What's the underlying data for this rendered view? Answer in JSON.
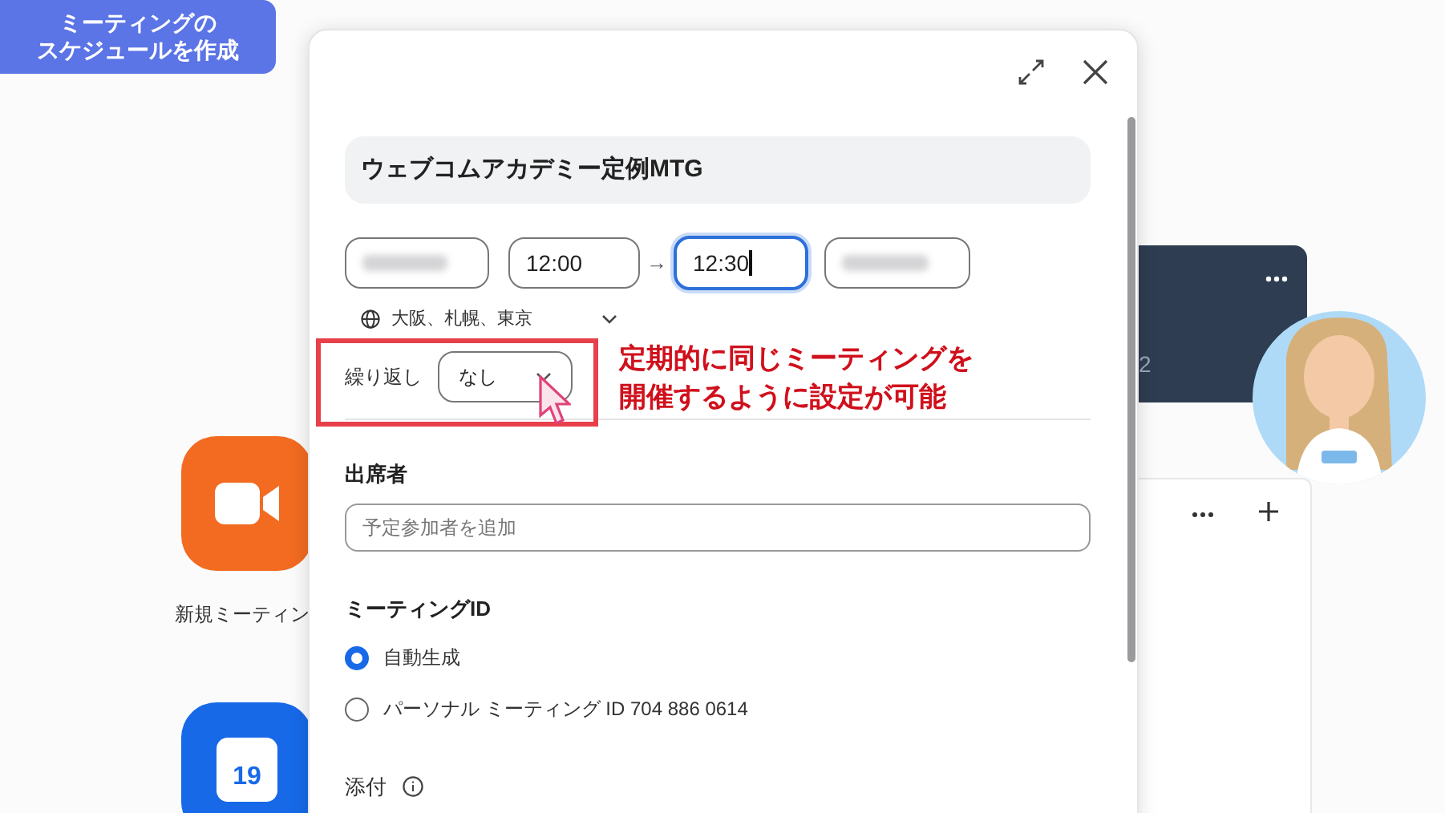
{
  "badge": {
    "lines": [
      "ミーティングの",
      "スケジュールを作成"
    ]
  },
  "background_app": {
    "new_meeting_label": "新規ミーティン",
    "calendar_day": "19",
    "card_text": "2"
  },
  "dialog": {
    "title_value": "ウェブコムアカデミー定例MTG",
    "start_time": "12:00",
    "arrow": "→",
    "end_time": "12:30",
    "end_time_focused": true,
    "timezone": "大阪、札幌、東京",
    "repeat": {
      "label": "繰り返し",
      "value": "なし"
    },
    "attendees": {
      "label": "出席者",
      "placeholder": "予定参加者を追加"
    },
    "meeting_id": {
      "label": "ミーティングID",
      "options": [
        {
          "label": "自動生成",
          "selected": true
        },
        {
          "label": "パーソナル ミーティング ID 704 886 0614",
          "selected": false
        }
      ]
    },
    "attachment": {
      "label": "添付"
    }
  },
  "annotation": {
    "lines": [
      "定期的に同じミーティングを",
      "開催するように設定が可能"
    ]
  }
}
